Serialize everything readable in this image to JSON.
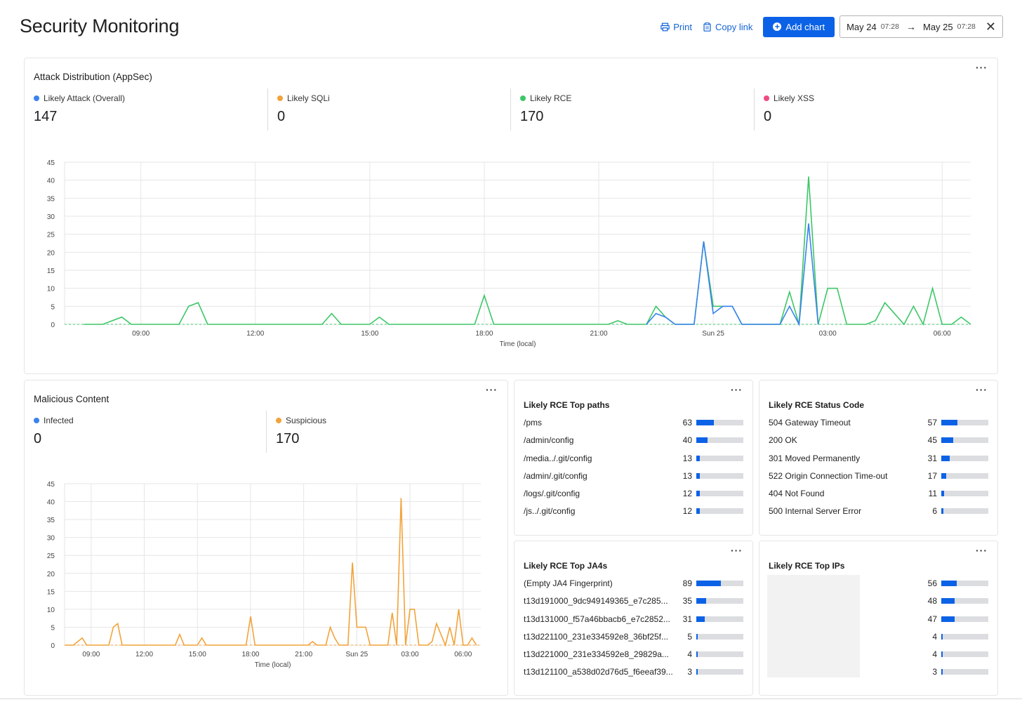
{
  "header": {
    "title": "Security Monitoring",
    "print_label": "Print",
    "copy_link_label": "Copy link",
    "add_chart_label": "Add chart",
    "date_from": "May 24",
    "time_from": "07:28",
    "date_to": "May 25",
    "time_to": "07:28"
  },
  "colors": {
    "blue": "#3a82f0",
    "orange": "#f2a33a",
    "green": "#3cc767",
    "pink": "#ef4a83",
    "accent": "#0b62e6"
  },
  "attack_panel": {
    "title": "Attack Distribution (AppSec)",
    "metrics": [
      {
        "label": "Likely Attack (Overall)",
        "value": "147",
        "color": "#3a82f0"
      },
      {
        "label": "Likely SQLi",
        "value": "0",
        "color": "#f2a33a"
      },
      {
        "label": "Likely RCE",
        "value": "170",
        "color": "#3cc767"
      },
      {
        "label": "Likely XSS",
        "value": "0",
        "color": "#ef4a83"
      }
    ]
  },
  "malicious_panel": {
    "title": "Malicious Content",
    "metrics": [
      {
        "label": "Infected",
        "value": "0",
        "color": "#3a82f0"
      },
      {
        "label": "Suspicious",
        "value": "170",
        "color": "#f2a33a"
      }
    ]
  },
  "rce_paths": {
    "title": "Likely RCE Top paths",
    "rows": [
      {
        "label": "/pms",
        "value": "63",
        "fraction": 0.38
      },
      {
        "label": "/admin/config",
        "value": "40",
        "fraction": 0.24
      },
      {
        "label": "/media../.git/config",
        "value": "13",
        "fraction": 0.08
      },
      {
        "label": "/admin/.git/config",
        "value": "13",
        "fraction": 0.08
      },
      {
        "label": "/logs/.git/config",
        "value": "12",
        "fraction": 0.07
      },
      {
        "label": "/js../.git/config",
        "value": "12",
        "fraction": 0.07
      }
    ]
  },
  "rce_status": {
    "title": "Likely RCE Status Code",
    "rows": [
      {
        "label": "504 Gateway Timeout",
        "value": "57",
        "fraction": 0.34
      },
      {
        "label": "200 OK",
        "value": "45",
        "fraction": 0.26
      },
      {
        "label": "301 Moved Permanently",
        "value": "31",
        "fraction": 0.18
      },
      {
        "label": "522 Origin Connection Time-out",
        "value": "17",
        "fraction": 0.1
      },
      {
        "label": "404 Not Found",
        "value": "11",
        "fraction": 0.06
      },
      {
        "label": "500 Internal Server Error",
        "value": "6",
        "fraction": 0.04
      }
    ]
  },
  "rce_ja4": {
    "title": "Likely RCE Top JA4s",
    "rows": [
      {
        "label": "(Empty JA4 Fingerprint)",
        "value": "89",
        "fraction": 0.52
      },
      {
        "label": "t13d191000_9dc949149365_e7c285...",
        "value": "35",
        "fraction": 0.21
      },
      {
        "label": "t13d131000_f57a46bbacb6_e7c2852...",
        "value": "31",
        "fraction": 0.18
      },
      {
        "label": "t13d221100_231e334592e8_36bf25f...",
        "value": "5",
        "fraction": 0.03
      },
      {
        "label": "t13d221000_231e334592e8_29829a...",
        "value": "4",
        "fraction": 0.02
      },
      {
        "label": "t13d121100_a538d02d76d5_f6eeaf39...",
        "value": "3",
        "fraction": 0.02
      }
    ]
  },
  "rce_ips": {
    "title": "Likely RCE Top IPs",
    "rows": [
      {
        "value": "56",
        "fraction": 0.33
      },
      {
        "value": "48",
        "fraction": 0.28
      },
      {
        "value": "47",
        "fraction": 0.28
      },
      {
        "value": "4",
        "fraction": 0.02
      },
      {
        "value": "4",
        "fraction": 0.02
      },
      {
        "value": "3",
        "fraction": 0.02
      }
    ]
  },
  "chart_data": [
    {
      "type": "line",
      "xlabel": "Time (local)",
      "ylabel": "",
      "ylim": [
        0,
        45
      ],
      "yticks": [
        0,
        5,
        10,
        15,
        20,
        25,
        30,
        35,
        40,
        45
      ],
      "xlim": [
        7.0,
        30.75
      ],
      "xticks": [
        {
          "x": 9,
          "label": "09:00"
        },
        {
          "x": 12,
          "label": "12:00"
        },
        {
          "x": 15,
          "label": "15:00"
        },
        {
          "x": 18,
          "label": "18:00"
        },
        {
          "x": 21,
          "label": "21:00"
        },
        {
          "x": 24,
          "label": "Sun 25"
        },
        {
          "x": 27,
          "label": "03:00"
        },
        {
          "x": 30,
          "label": "06:00"
        }
      ],
      "grid": true,
      "legend": "none",
      "series": [
        {
          "color": "#3cc767",
          "points": [
            [
              7.5,
              0
            ],
            [
              8,
              0
            ],
            [
              8.5,
              2
            ],
            [
              8.75,
              0
            ],
            [
              10,
              0
            ],
            [
              10.25,
              5
            ],
            [
              10.5,
              6
            ],
            [
              10.75,
              0
            ],
            [
              13.75,
              0
            ],
            [
              14,
              3
            ],
            [
              14.25,
              0
            ],
            [
              15,
              0
            ],
            [
              15.25,
              2
            ],
            [
              15.5,
              0
            ],
            [
              17.75,
              0
            ],
            [
              18,
              8
            ],
            [
              18.25,
              0
            ],
            [
              21.25,
              0
            ],
            [
              21.5,
              1
            ],
            [
              21.75,
              0
            ],
            [
              22.25,
              0
            ],
            [
              22.5,
              5
            ],
            [
              22.75,
              2
            ],
            [
              23,
              0
            ],
            [
              23.5,
              0
            ],
            [
              23.75,
              23
            ],
            [
              24,
              5
            ],
            [
              24.25,
              5
            ],
            [
              24.5,
              5
            ],
            [
              24.75,
              0
            ],
            [
              25.75,
              0
            ],
            [
              26,
              9
            ],
            [
              26.25,
              0
            ],
            [
              26.5,
              41
            ],
            [
              26.75,
              0
            ],
            [
              27,
              10
            ],
            [
              27.25,
              10
            ],
            [
              27.5,
              0
            ],
            [
              28,
              0
            ],
            [
              28.25,
              1
            ],
            [
              28.5,
              6
            ],
            [
              29,
              0
            ],
            [
              29.25,
              5
            ],
            [
              29.5,
              0
            ],
            [
              29.75,
              10
            ],
            [
              30,
              0
            ],
            [
              30.25,
              0
            ],
            [
              30.5,
              2
            ],
            [
              30.75,
              0
            ]
          ]
        },
        {
          "color": "#3a82f0",
          "points": [
            [
              22.25,
              0
            ],
            [
              22.5,
              3
            ],
            [
              22.75,
              2
            ],
            [
              23,
              0
            ],
            [
              23.5,
              0
            ],
            [
              23.75,
              23
            ],
            [
              24,
              3
            ],
            [
              24.25,
              5
            ],
            [
              24.5,
              5
            ],
            [
              24.75,
              0
            ],
            [
              25.75,
              0
            ],
            [
              26,
              5
            ],
            [
              26.25,
              0
            ],
            [
              26.5,
              28
            ],
            [
              26.75,
              0
            ]
          ]
        }
      ]
    },
    {
      "type": "line",
      "xlabel": "Time (local)",
      "ylabel": "",
      "ylim": [
        0,
        45
      ],
      "yticks": [
        0,
        5,
        10,
        15,
        20,
        25,
        30,
        35,
        40,
        45
      ],
      "xlim": [
        7.5,
        31.0
      ],
      "xticks": [
        {
          "x": 9,
          "label": "09:00"
        },
        {
          "x": 12,
          "label": "12:00"
        },
        {
          "x": 15,
          "label": "15:00"
        },
        {
          "x": 18,
          "label": "18:00"
        },
        {
          "x": 21,
          "label": "21:00"
        },
        {
          "x": 24,
          "label": "Sun 25"
        },
        {
          "x": 27,
          "label": "03:00"
        },
        {
          "x": 30,
          "label": "06:00"
        }
      ],
      "grid": true,
      "legend": "none",
      "series": [
        {
          "color": "#f2a33a",
          "points": [
            [
              7.5,
              0
            ],
            [
              8,
              0
            ],
            [
              8.5,
              2
            ],
            [
              8.75,
              0
            ],
            [
              10,
              0
            ],
            [
              10.25,
              5
            ],
            [
              10.5,
              6
            ],
            [
              10.75,
              0
            ],
            [
              13.75,
              0
            ],
            [
              14,
              3
            ],
            [
              14.25,
              0
            ],
            [
              15,
              0
            ],
            [
              15.25,
              2
            ],
            [
              15.5,
              0
            ],
            [
              17.75,
              0
            ],
            [
              18,
              8
            ],
            [
              18.25,
              0
            ],
            [
              21.25,
              0
            ],
            [
              21.5,
              1
            ],
            [
              21.75,
              0
            ],
            [
              22.25,
              0
            ],
            [
              22.5,
              5
            ],
            [
              22.75,
              2
            ],
            [
              23,
              0
            ],
            [
              23.5,
              0
            ],
            [
              23.75,
              23
            ],
            [
              24,
              5
            ],
            [
              24.25,
              5
            ],
            [
              24.5,
              5
            ],
            [
              24.75,
              0
            ],
            [
              25.75,
              0
            ],
            [
              26,
              9
            ],
            [
              26.25,
              0
            ],
            [
              26.5,
              41
            ],
            [
              26.75,
              0
            ],
            [
              27,
              10
            ],
            [
              27.25,
              10
            ],
            [
              27.5,
              0
            ],
            [
              28,
              0
            ],
            [
              28.25,
              1
            ],
            [
              28.5,
              6
            ],
            [
              29,
              0
            ],
            [
              29.25,
              5
            ],
            [
              29.5,
              0
            ],
            [
              29.75,
              10
            ],
            [
              30,
              0
            ],
            [
              30.25,
              0
            ],
            [
              30.5,
              2
            ],
            [
              30.75,
              0
            ]
          ]
        }
      ]
    }
  ]
}
